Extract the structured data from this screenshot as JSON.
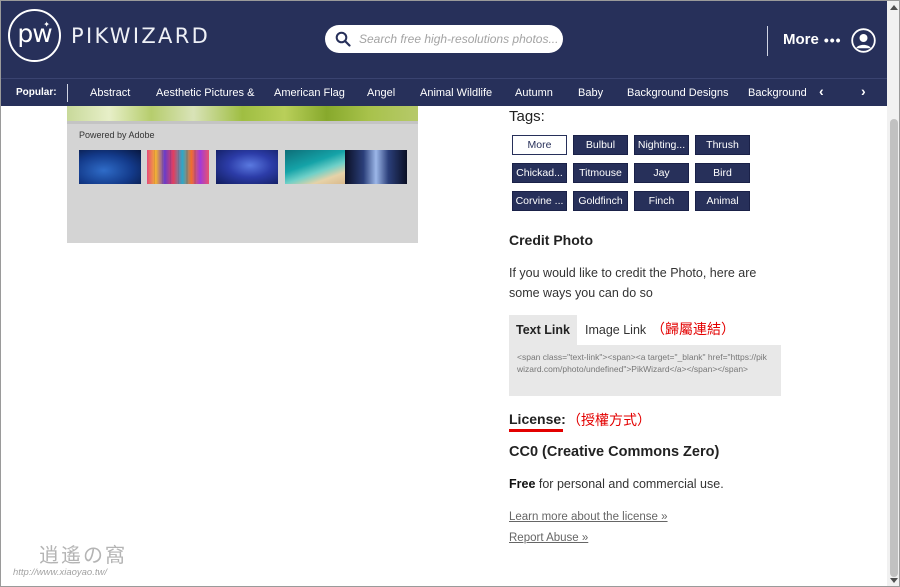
{
  "header": {
    "logo_mark": "pw",
    "logo_text": "PIKWIZARD",
    "search_placeholder": "Search free high-resolutions photos...",
    "more_label": "More",
    "more_dots": "•••"
  },
  "popular": {
    "label": "Popular:",
    "items": [
      "Abstract",
      "Aesthetic Pictures &",
      "American Flag",
      "Angel",
      "Animal Wildlife",
      "Autumn",
      "Baby",
      "Background Designs",
      "Background"
    ]
  },
  "adobe": {
    "label": "Powered by Adobe"
  },
  "tags": {
    "title": "Tags:",
    "items": [
      "More",
      "Bulbul",
      "Nighting...",
      "Thrush",
      "Chickad...",
      "Titmouse",
      "Jay",
      "Bird",
      "Corvine ...",
      "Goldfinch",
      "Finch",
      "Animal"
    ]
  },
  "credit": {
    "title": "Credit Photo",
    "description": "If you would like to credit the Photo, here are some ways you can do so",
    "tab_text": "Text Link",
    "tab_image": "Image Link",
    "code": "<span class=\"text-link\"><span><a target=\"_blank\" href=\"https://pikwizard.com/photo/undefined\">PikWizard</a></span></span>"
  },
  "annotations": {
    "link": "（歸屬連結）",
    "license": "（授權方式）"
  },
  "license": {
    "label": "License",
    "colon": ":",
    "type": "CC0 (Creative Commons Zero)",
    "free_bold": "Free",
    "free_rest": " for personal and commercial use.",
    "learn_more": "Learn more about the license »",
    "report": "Report Abuse »"
  },
  "watermark": {
    "mark": "逍遙の窩",
    "url": "http://www.xiaoyao.tw/"
  },
  "colors": {
    "brand_navy": "#27305a",
    "annotation_red": "#e30000"
  }
}
